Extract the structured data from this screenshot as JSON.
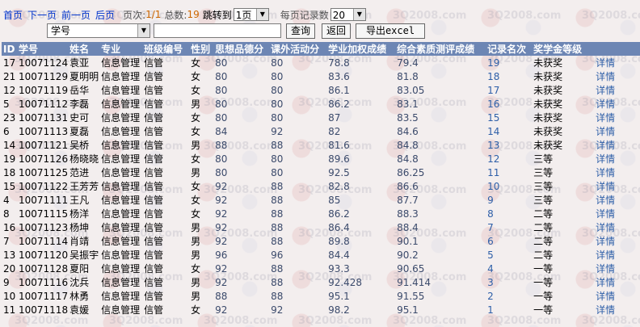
{
  "pager": {
    "first": "首页",
    "next": "下一页",
    "prev": "前一页",
    "last": "后页",
    "page_label": "页次:",
    "page_value": "1/1",
    "total_label": "总数:",
    "total_value": "19",
    "jump_label": "跳转到",
    "jump_value": "1页",
    "per_page_label": "每页记录数",
    "per_page_value": "20"
  },
  "search": {
    "field_value": "学号",
    "input_value": "",
    "query_label": "查询",
    "back_label": "返回",
    "export_label": "导出excel"
  },
  "table": {
    "headers": [
      "ID",
      "学号",
      "姓名",
      "专业",
      "班级编号",
      "性别",
      "思想品德分",
      "课外活动分",
      "学业加权成绩",
      "综合素质测评成绩",
      "记录名次",
      "奖学金等级",
      ""
    ],
    "rows": [
      [
        "17",
        "10071124",
        "袁亚",
        "信息管理",
        "信管",
        "女",
        "80",
        "80",
        "78.8",
        "79.4",
        "19",
        "未获奖",
        "详情"
      ],
      [
        "21",
        "10071129",
        "夏明明",
        "信息管理",
        "信管",
        "女",
        "80",
        "80",
        "83.6",
        "81.8",
        "18",
        "未获奖",
        "详情"
      ],
      [
        "12",
        "10071119",
        "岳华",
        "信息管理",
        "信管",
        "女",
        "80",
        "80",
        "86.1",
        "83.05",
        "17",
        "未获奖",
        "详情"
      ],
      [
        "5",
        "10071112",
        "李磊",
        "信息管理",
        "信管",
        "男",
        "80",
        "80",
        "86.2",
        "83.1",
        "16",
        "未获奖",
        "详情"
      ],
      [
        "23",
        "10071131",
        "史可",
        "信息管理",
        "信管",
        "女",
        "80",
        "80",
        "87",
        "83.5",
        "15",
        "未获奖",
        "详情"
      ],
      [
        "6",
        "10071113",
        "夏磊",
        "信息管理",
        "信管",
        "女",
        "84",
        "92",
        "82",
        "84.6",
        "14",
        "未获奖",
        "详情"
      ],
      [
        "14",
        "10071121",
        "吴桥",
        "信息管理",
        "信管",
        "男",
        "88",
        "88",
        "81.6",
        "84.8",
        "13",
        "未获奖",
        "详情"
      ],
      [
        "19",
        "10071126",
        "杨晓晓",
        "信息管理",
        "信管",
        "女",
        "80",
        "80",
        "89.6",
        "84.8",
        "12",
        "三等",
        "详情"
      ],
      [
        "18",
        "10071125",
        "范进",
        "信息管理",
        "信管",
        "男",
        "80",
        "80",
        "92.5",
        "86.25",
        "11",
        "三等",
        "详情"
      ],
      [
        "15",
        "10071122",
        "王芳芳",
        "信息管理",
        "信管",
        "女",
        "92",
        "88",
        "82.8",
        "86.6",
        "10",
        "三等",
        "详情"
      ],
      [
        "4",
        "10071111",
        "王凡",
        "信息管理",
        "信管",
        "女",
        "92",
        "88",
        "85",
        "87.7",
        "9",
        "三等",
        "详情"
      ],
      [
        "8",
        "10071115",
        "杨洋",
        "信息管理",
        "信管",
        "女",
        "92",
        "88",
        "86.2",
        "88.3",
        "8",
        "二等",
        "详情"
      ],
      [
        "16",
        "10071123",
        "杨坤",
        "信息管理",
        "信管",
        "男",
        "92",
        "88",
        "86.4",
        "88.4",
        "7",
        "二等",
        "详情"
      ],
      [
        "7",
        "10071114",
        "肖靖",
        "信息管理",
        "信管",
        "男",
        "92",
        "88",
        "89.8",
        "90.1",
        "6",
        "二等",
        "详情"
      ],
      [
        "13",
        "10071120",
        "吴振宇",
        "信息管理",
        "信管",
        "男",
        "96",
        "96",
        "84.4",
        "90.2",
        "5",
        "二等",
        "详情"
      ],
      [
        "20",
        "10071128",
        "夏阳",
        "信息管理",
        "信管",
        "女",
        "92",
        "88",
        "93.3",
        "90.65",
        "4",
        "一等",
        "详情"
      ],
      [
        "9",
        "10071116",
        "沈兵",
        "信息管理",
        "信管",
        "男",
        "92",
        "88",
        "92.428",
        "91.414",
        "3",
        "一等",
        "详情"
      ],
      [
        "10",
        "10071117",
        "林勇",
        "信息管理",
        "信管",
        "男",
        "88",
        "88",
        "95.1",
        "91.55",
        "2",
        "一等",
        "详情"
      ],
      [
        "11",
        "10071118",
        "袁媛",
        "信息管理",
        "信管",
        "女",
        "92",
        "92",
        "98.2",
        "95.1",
        "1",
        "一等",
        "详情"
      ]
    ]
  },
  "watermark": "3Q2008.com",
  "colors": {
    "header_bg": "#6d86b4",
    "link": "#0033cc",
    "accent_number": "#cc6600"
  }
}
